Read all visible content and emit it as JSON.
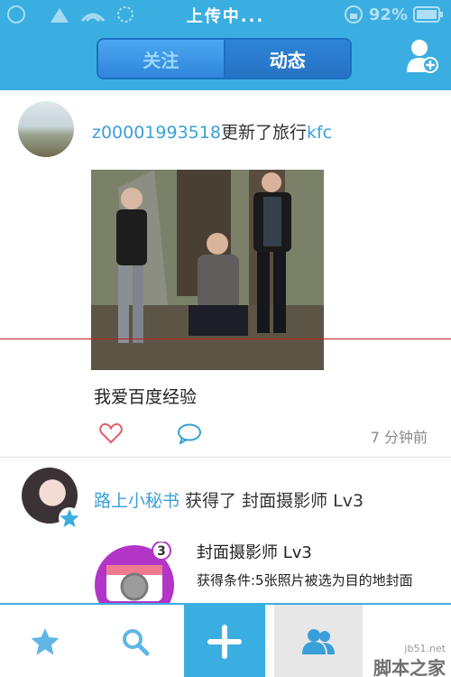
{
  "status_bar": {
    "title": "上传中...",
    "battery": "92%"
  },
  "nav": {
    "tabs": [
      {
        "label": "关注"
      },
      {
        "label": "动态"
      }
    ]
  },
  "post1": {
    "username": "z00001993518",
    "action": "更新了旅行",
    "target": "kfc",
    "caption": "我爱百度经验",
    "time": "7 分钟前"
  },
  "post2": {
    "username": "路上小秘书",
    "action": " 获得了 封面摄影师 Lv3",
    "badge": {
      "level_count": "3",
      "title": "封面摄影师 Lv3",
      "condition": "获得条件:5张照片被选为目的地封面"
    }
  },
  "watermark": {
    "site": "jb51.net",
    "name": "脚本之家"
  },
  "colors": {
    "accent": "#3aaee0",
    "link": "#3a9fd8",
    "segment": "#2f86dc",
    "badge_purple": "#b235c8",
    "heart": "#e35d6a"
  }
}
